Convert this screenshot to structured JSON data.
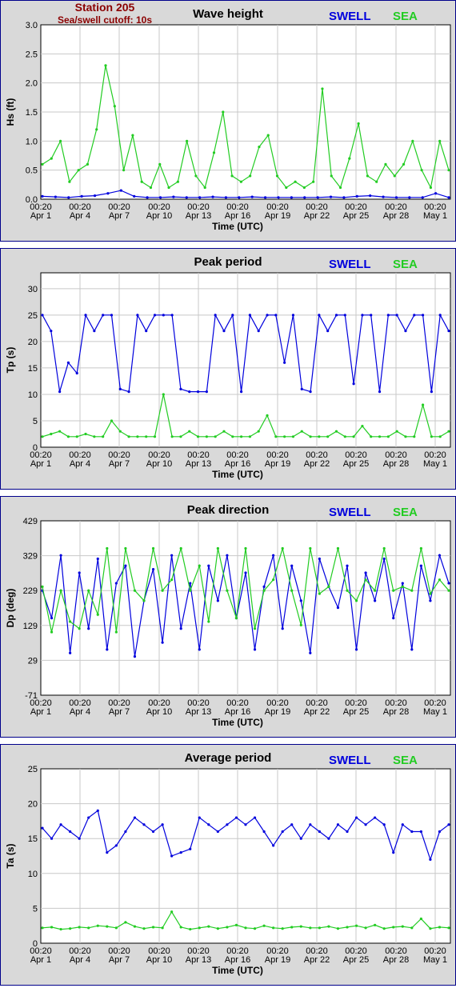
{
  "colors": {
    "swell": "#0000dd",
    "sea": "#22cc22",
    "panel_bg": "#d9d9d9",
    "border": "#00008b",
    "header": "#8b0000"
  },
  "header": {
    "station": "Station 205",
    "cutoff": "Sea/swell cutoff: 10s"
  },
  "legend": {
    "swell": "SWELL",
    "sea": "SEA"
  },
  "x_ticks": [
    {
      "time": "00:20",
      "date": "Apr 1"
    },
    {
      "time": "00:20",
      "date": "Apr 4"
    },
    {
      "time": "00:20",
      "date": "Apr 7"
    },
    {
      "time": "00:20",
      "date": "Apr 10"
    },
    {
      "time": "00:20",
      "date": "Apr 13"
    },
    {
      "time": "00:20",
      "date": "Apr 16"
    },
    {
      "time": "00:20",
      "date": "Apr 19"
    },
    {
      "time": "00:20",
      "date": "Apr 22"
    },
    {
      "time": "00:20",
      "date": "Apr 25"
    },
    {
      "time": "00:20",
      "date": "Apr 28"
    },
    {
      "time": "00:20",
      "date": "May 1"
    }
  ],
  "chart_data": [
    {
      "type": "line",
      "title": "Wave height",
      "xlabel": "Time (UTC)",
      "ylabel": "Hs (ft)",
      "ylim": [
        0,
        3.0
      ],
      "yticks": [
        "0.0",
        "0.5",
        "1.0",
        "1.5",
        "2.0",
        "2.5",
        "3.0"
      ],
      "x_days": [
        0,
        1,
        2,
        3,
        4,
        5,
        6,
        7,
        8,
        9,
        10,
        11,
        12,
        13,
        14,
        15,
        16,
        17,
        18,
        19,
        20,
        21,
        22,
        23,
        24,
        25,
        26,
        27,
        28,
        29,
        30,
        31
      ],
      "series": [
        {
          "name": "SWELL",
          "values": [
            0.05,
            0.04,
            0.03,
            0.05,
            0.06,
            0.1,
            0.15,
            0.05,
            0.03,
            0.03,
            0.04,
            0.03,
            0.03,
            0.04,
            0.03,
            0.03,
            0.04,
            0.03,
            0.03,
            0.03,
            0.03,
            0.03,
            0.04,
            0.03,
            0.05,
            0.06,
            0.04,
            0.03,
            0.03,
            0.03,
            0.1,
            0.03
          ]
        },
        {
          "name": "SEA",
          "values": [
            0.6,
            0.7,
            1.0,
            0.3,
            0.5,
            0.6,
            1.2,
            2.3,
            1.6,
            0.5,
            1.1,
            0.3,
            0.2,
            0.6,
            0.2,
            0.3,
            1.0,
            0.4,
            0.2,
            0.8,
            1.5,
            0.4,
            0.3,
            0.4,
            0.9,
            1.1,
            0.4,
            0.2,
            0.3,
            0.2,
            0.3,
            1.9,
            0.4,
            0.2,
            0.7,
            1.3,
            0.4,
            0.3,
            0.6,
            0.4,
            0.6,
            1.0,
            0.5,
            0.2,
            1.0,
            0.5
          ]
        }
      ]
    },
    {
      "type": "line",
      "title": "Peak period",
      "xlabel": "Time (UTC)",
      "ylabel": "Tp (s)",
      "ylim": [
        0,
        33
      ],
      "yticks": [
        "0",
        "5",
        "10",
        "15",
        "20",
        "25",
        "30"
      ],
      "series": [
        {
          "name": "SWELL",
          "values": [
            25,
            22,
            10.5,
            16,
            14,
            25,
            22,
            25,
            25,
            11,
            10.5,
            25,
            22,
            25,
            25,
            25,
            11,
            10.5,
            10.5,
            10.5,
            25,
            22,
            25,
            10.5,
            25,
            22,
            25,
            25,
            16,
            25,
            11,
            10.5,
            25,
            22,
            25,
            25,
            12,
            25,
            25,
            10.5,
            25,
            25,
            22,
            25,
            25,
            10.5,
            25,
            22
          ]
        },
        {
          "name": "SEA",
          "values": [
            2,
            2.5,
            3,
            2,
            2,
            2.5,
            2,
            2,
            5,
            3,
            2,
            2,
            2,
            2,
            10,
            2,
            2,
            3,
            2,
            2,
            2,
            3,
            2,
            2,
            2,
            3,
            6,
            2,
            2,
            2,
            3,
            2,
            2,
            2,
            3,
            2,
            2,
            4,
            2,
            2,
            2,
            3,
            2,
            2,
            8,
            2,
            2,
            3
          ]
        }
      ]
    },
    {
      "type": "line",
      "title": "Peak direction",
      "xlabel": "Time (UTC)",
      "ylabel": "Dp (deg)",
      "ylim": [
        -71,
        429
      ],
      "yticks": [
        "-71",
        "29",
        "129",
        "229",
        "329",
        "429"
      ],
      "series": [
        {
          "name": "SWELL",
          "values": [
            229,
            150,
            330,
            50,
            280,
            120,
            320,
            60,
            250,
            300,
            40,
            200,
            290,
            80,
            330,
            120,
            250,
            60,
            300,
            200,
            330,
            150,
            280,
            60,
            240,
            330,
            120,
            300,
            200,
            50,
            320,
            240,
            180,
            300,
            60,
            280,
            200,
            320,
            150,
            250,
            60,
            300,
            200,
            330,
            250
          ]
        },
        {
          "name": "SEA",
          "values": [
            240,
            110,
            229,
            140,
            120,
            229,
            160,
            350,
            110,
            350,
            229,
            200,
            350,
            229,
            260,
            350,
            229,
            300,
            140,
            350,
            229,
            150,
            350,
            120,
            229,
            260,
            350,
            229,
            130,
            350,
            220,
            240,
            350,
            229,
            200,
            260,
            229,
            350,
            229,
            240,
            229,
            350,
            220,
            260,
            229
          ]
        }
      ]
    },
    {
      "type": "line",
      "title": "Average period",
      "xlabel": "Time (UTC)",
      "ylabel": "Ta (s)",
      "ylim": [
        0,
        25
      ],
      "yticks": [
        "0",
        "5",
        "10",
        "15",
        "20",
        "25"
      ],
      "series": [
        {
          "name": "SWELL",
          "values": [
            16.5,
            15,
            17,
            16,
            15,
            18,
            19,
            13,
            14,
            16,
            18,
            17,
            16,
            17,
            12.5,
            13,
            13.5,
            18,
            17,
            16,
            17,
            18,
            17,
            18,
            16,
            14,
            16,
            17,
            15,
            17,
            16,
            15,
            17,
            16,
            18,
            17,
            18,
            17,
            13,
            17,
            16,
            16,
            12,
            16,
            17
          ]
        },
        {
          "name": "SEA",
          "values": [
            2.2,
            2.3,
            2.0,
            2.1,
            2.3,
            2.2,
            2.5,
            2.4,
            2.2,
            3.0,
            2.4,
            2.1,
            2.3,
            2.2,
            4.5,
            2.3,
            2.0,
            2.2,
            2.4,
            2.1,
            2.3,
            2.6,
            2.2,
            2.1,
            2.5,
            2.2,
            2.1,
            2.3,
            2.4,
            2.2,
            2.2,
            2.4,
            2.1,
            2.3,
            2.5,
            2.2,
            2.6,
            2.1,
            2.3,
            2.4,
            2.2,
            3.5,
            2.1,
            2.3,
            2.2
          ]
        }
      ]
    }
  ]
}
